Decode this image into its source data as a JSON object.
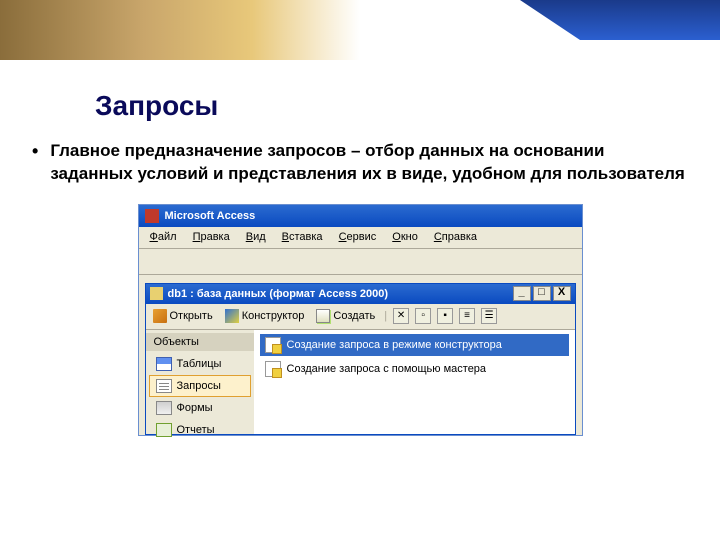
{
  "title": "Запросы",
  "bullet_text": "Главное предназначение запросов – отбор данных на основании заданных условий и представления их в виде, удобном для пользователя",
  "app": {
    "title": "Microsoft Access",
    "menu": [
      "Файл",
      "Правка",
      "Вид",
      "Вставка",
      "Сервис",
      "Окно",
      "Справка"
    ]
  },
  "db": {
    "title": "db1 : база данных (формат Access 2000)",
    "win_buttons": [
      "_",
      "□",
      "X"
    ],
    "toolbar": {
      "open": "Открыть",
      "design": "Конструктор",
      "create": "Создать"
    },
    "sidebar": {
      "header": "Объекты",
      "items": [
        {
          "label": "Таблицы",
          "icon": "table"
        },
        {
          "label": "Запросы",
          "icon": "query",
          "selected": true
        },
        {
          "label": "Формы",
          "icon": "form"
        },
        {
          "label": "Отчеты",
          "icon": "report"
        }
      ]
    },
    "content": [
      {
        "label": "Создание запроса в режиме конструктора",
        "hl": true
      },
      {
        "label": "Создание запроса с помощью мастера",
        "hl": false
      }
    ]
  }
}
